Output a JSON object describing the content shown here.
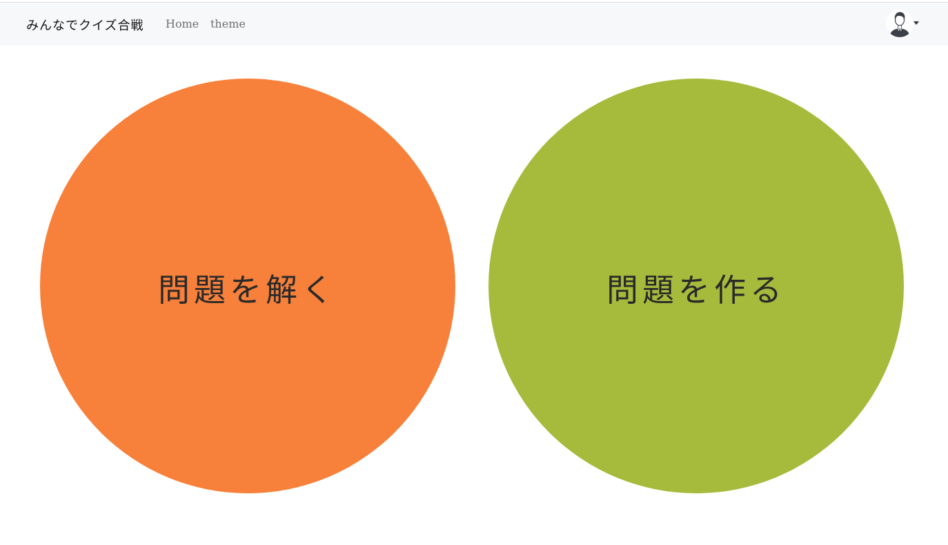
{
  "navbar": {
    "brand": "みんなでクイズ合戦",
    "links": [
      {
        "label": "Home"
      },
      {
        "label": "theme"
      }
    ],
    "user_icon": "user-avatar-icon"
  },
  "main": {
    "buttons": [
      {
        "label": "問題を解く",
        "color": "#f7803a"
      },
      {
        "label": "問題を作る",
        "color": "#a6bb3c"
      }
    ]
  }
}
